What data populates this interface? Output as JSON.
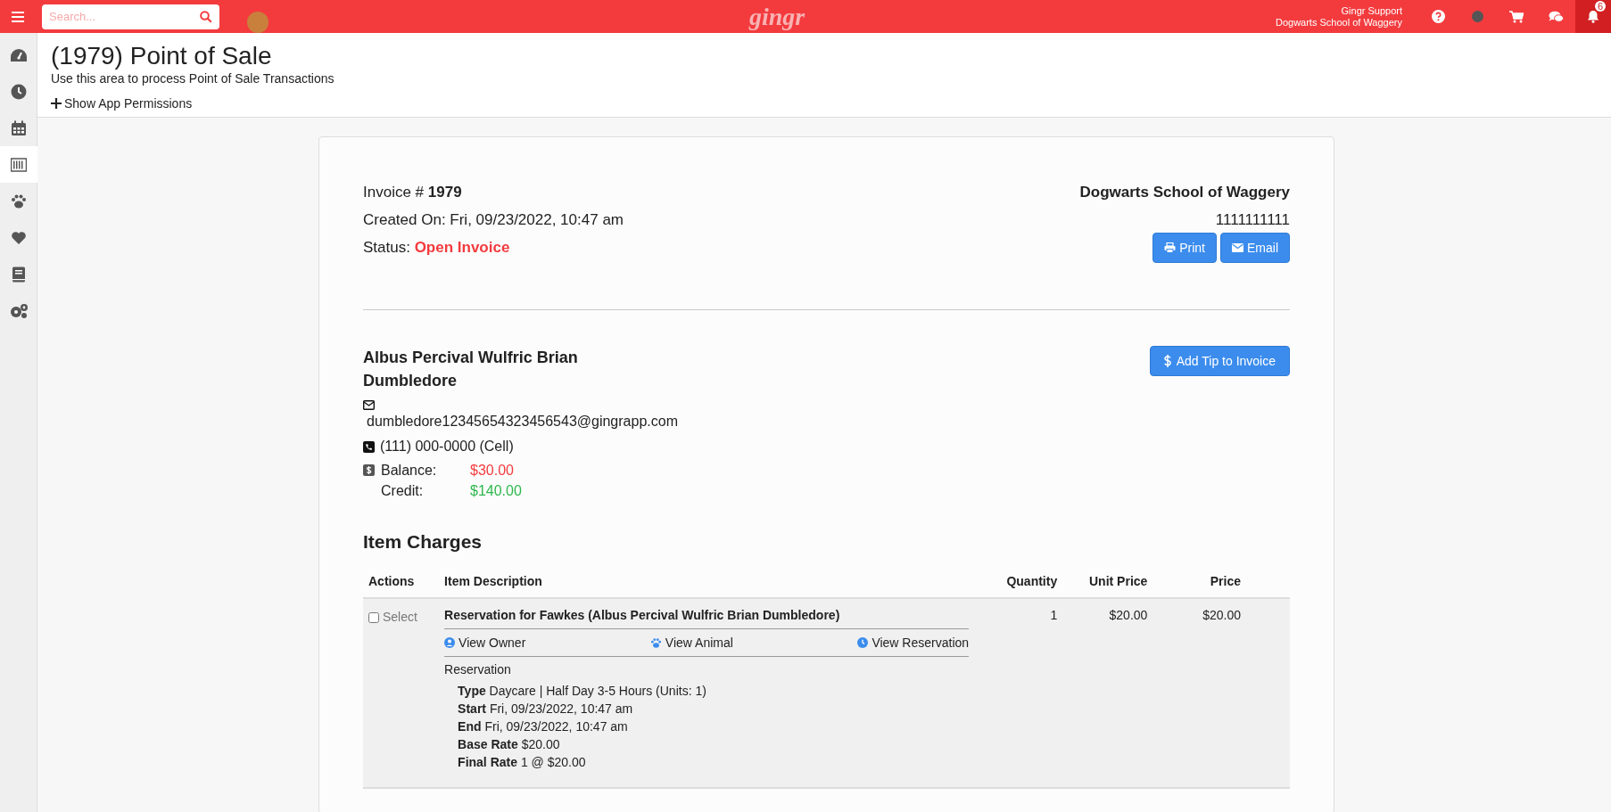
{
  "top_bar": {
    "search": {
      "placeholder": "Search..."
    },
    "logo": "gingr",
    "user": {
      "name": "Gingr Support",
      "company": "Dogwarts School of Waggery"
    },
    "notifications": {
      "count": "6"
    }
  },
  "sidebar": {
    "items": [
      {
        "kind": "dashboard",
        "selected": false
      },
      {
        "kind": "clock",
        "selected": false
      },
      {
        "kind": "calendar",
        "selected": false
      },
      {
        "kind": "barcode",
        "selected": true
      },
      {
        "kind": "paw",
        "selected": false
      },
      {
        "kind": "heart",
        "selected": false
      },
      {
        "kind": "book",
        "selected": false
      },
      {
        "kind": "gears",
        "selected": false
      }
    ]
  },
  "page": {
    "title": "(1979) Point of Sale",
    "subtitle": "Use this area to process Point of Sale Transactions",
    "permissions_link": "Show App Permissions"
  },
  "invoice": {
    "number_label": "Invoice #",
    "number": "1979",
    "created": "Created On: Fri, 09/23/2022, 10:47 am",
    "status_label": "Status:",
    "status": "Open Invoice",
    "business": "Dogwarts School of Waggery",
    "phone": "1111111111",
    "buttons": [
      {
        "kind": "print",
        "label": "Print"
      },
      {
        "kind": "email",
        "label": "Email"
      }
    ]
  },
  "customer": {
    "name": "Albus Percival Wulfric Brian Dumbledore",
    "email": "dumbledore12345654323456543@gingrapp.com",
    "phone": "(111) 000-0000 (Cell)",
    "balance_label": "Balance:",
    "balance": "$30.00",
    "credit_label": "Credit:",
    "credit": "$140.00",
    "tip_button": "Add Tip to Invoice"
  },
  "item_charges": {
    "title": "Item Charges",
    "columns": [
      "Actions",
      "Item Description",
      "Quantity",
      "Unit Price",
      "Price"
    ],
    "rows": [
      {
        "checked": false,
        "select_label": "Select",
        "description": "Reservation for Fawkes (Albus Percival Wulfric Brian Dumbledore)",
        "links": [
          {
            "kind": "owner",
            "label": "View Owner"
          },
          {
            "kind": "animal",
            "label": "View Animal"
          },
          {
            "kind": "reservation",
            "label": "View Reservation"
          }
        ],
        "section": "Reservation",
        "details": [
          {
            "label": "Type",
            "value": "Daycare | Half Day 3-5 Hours (Units: 1)"
          },
          {
            "label": "Start",
            "value": "Fri, 09/23/2022, 10:47 am"
          },
          {
            "label": "End",
            "value": "Fri, 09/23/2022, 10:47 am"
          },
          {
            "label": "Base Rate",
            "value": "$20.00"
          },
          {
            "label": "Final Rate",
            "value": "1 @ $20.00"
          }
        ],
        "quantity": "1",
        "unit_price": "$20.00",
        "price": "$20.00"
      }
    ]
  }
}
